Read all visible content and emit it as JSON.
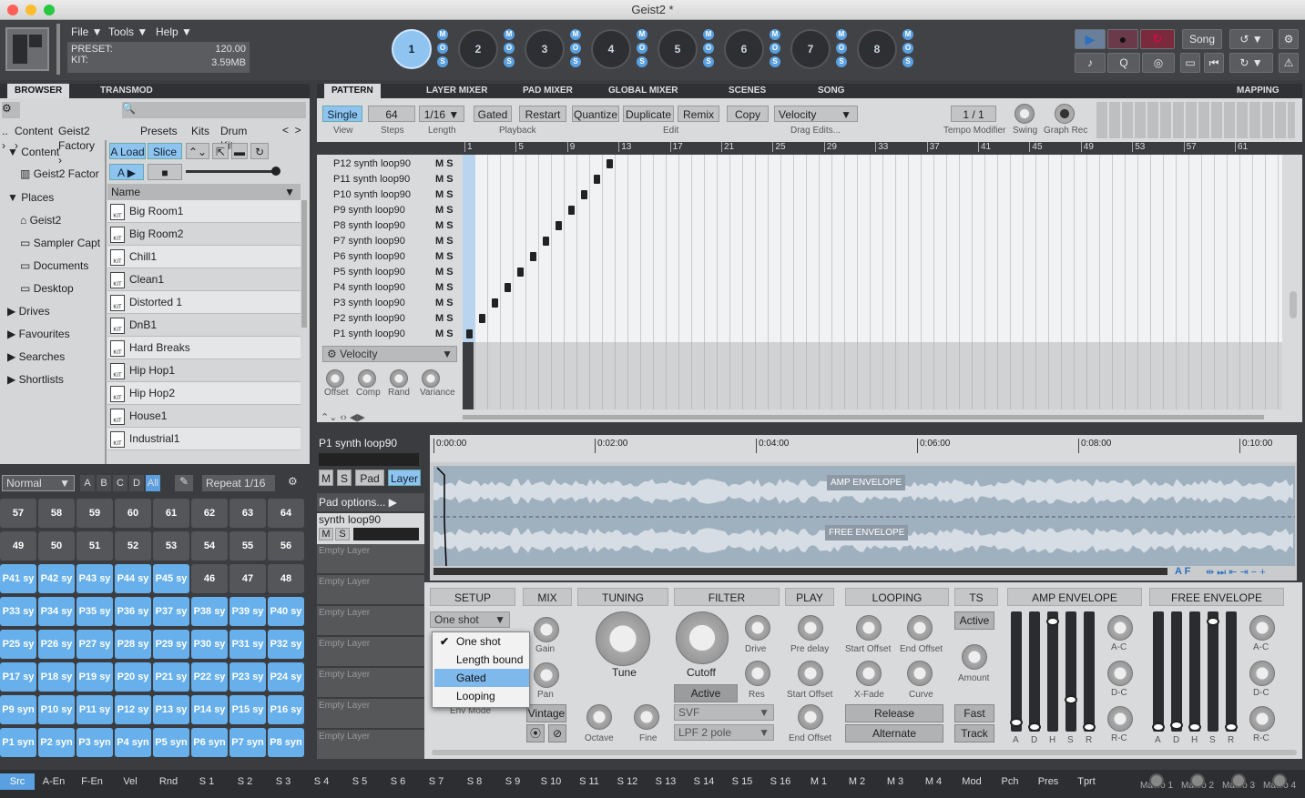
{
  "window": {
    "title": "Geist2 *"
  },
  "menu": {
    "file": "File ▼",
    "tools": "Tools ▼",
    "help": "Help ▼"
  },
  "info": {
    "preset_label": "PRESET:",
    "kit_label": "KIT:",
    "tempo": "120.00",
    "size": "3.59MB"
  },
  "engines": [
    "1",
    "2",
    "3",
    "4",
    "5",
    "6",
    "7",
    "8"
  ],
  "engine_flags": [
    "M",
    "O",
    "S"
  ],
  "transport": {
    "song": "Song"
  },
  "left_tabs": {
    "browser": "BROWSER",
    "transmod": "TRANSMOD"
  },
  "main_tabs": [
    "PATTERN",
    "LAYER MIXER",
    "PAD MIXER",
    "GLOBAL MIXER",
    "SCENES",
    "SONG"
  ],
  "mapping": "MAPPING",
  "breadcrumb": [
    "..",
    "Content",
    "Geist2 Factory",
    "Presets",
    "Kits",
    "Drum Kits"
  ],
  "tree": {
    "content": "Content",
    "geist2_factory": "Geist2 Factor",
    "places": "Places",
    "geist2": "Geist2",
    "sampler": "Sampler Capt",
    "documents": "Documents",
    "desktop": "Desktop",
    "drives": "Drives",
    "favourites": "Favourites",
    "searches": "Searches",
    "shortlists": "Shortlists"
  },
  "browser_btns": {
    "load": "A Load",
    "slice": "Slice",
    "a": "A ▶",
    "name": "Name"
  },
  "files": [
    "Big Room1",
    "Big Room2",
    "Chill1",
    "Clean1",
    "Distorted 1",
    "DnB1",
    "Hard Breaks",
    "Hip Hop1",
    "Hip Hop2",
    "House1",
    "Industrial1"
  ],
  "pads_toolbar": {
    "mode": "Normal",
    "banks": [
      "A",
      "B",
      "C",
      "D",
      "All"
    ],
    "repeat": "Repeat",
    "repeat_val": "1/16"
  },
  "pad_rows": [
    [
      "57",
      "58",
      "59",
      "60",
      "61",
      "62",
      "63",
      "64"
    ],
    [
      "49",
      "50",
      "51",
      "52",
      "53",
      "54",
      "55",
      "56"
    ],
    [
      "P41 sy",
      "P42 sy",
      "P43 sy",
      "P44 sy",
      "P45 sy",
      "46",
      "47",
      "48"
    ],
    [
      "P33 sy",
      "P34 sy",
      "P35 sy",
      "P36 sy",
      "P37 sy",
      "P38 sy",
      "P39 sy",
      "P40 sy"
    ],
    [
      "P25 sy",
      "P26 sy",
      "P27 sy",
      "P28 sy",
      "P29 sy",
      "P30 sy",
      "P31 sy",
      "P32 sy"
    ],
    [
      "P17 sy",
      "P18 sy",
      "P19 sy",
      "P20 sy",
      "P21 sy",
      "P22 sy",
      "P23 sy",
      "P24 sy"
    ],
    [
      "P9 syn",
      "P10 sy",
      "P11 sy",
      "P12 sy",
      "P13 sy",
      "P14 sy",
      "P15 sy",
      "P16 sy"
    ],
    [
      "P1 syn",
      "P2 syn",
      "P3 syn",
      "P4 syn",
      "P5 syn",
      "P6 syn",
      "P7 syn",
      "P8 syn"
    ]
  ],
  "pattern_toolbar": {
    "single": "Single",
    "steps": "64",
    "length": "1/16 ▼",
    "gated": "Gated",
    "restart": "Restart",
    "quantize": "Quantize",
    "duplicate": "Duplicate",
    "remix": "Remix",
    "copy": "Copy",
    "velocity": "Velocity",
    "page": "1 / 1",
    "view": "View",
    "steps_lbl": "Steps",
    "length_lbl": "Length",
    "playback": "Playback",
    "edit": "Edit",
    "drag": "Drag Edits...",
    "tempo_mod": "Tempo Modifier",
    "swing": "Swing",
    "graph_rec": "Graph Rec"
  },
  "ruler": [
    "1",
    "5",
    "9",
    "13",
    "17",
    "21",
    "25",
    "29",
    "33",
    "37",
    "41",
    "45",
    "49",
    "53",
    "57",
    "61"
  ],
  "pattern_rows": [
    "P12 synth loop90",
    "P11 synth loop90",
    "P10 synth loop90",
    "P9 synth loop90",
    "P8 synth loop90",
    "P7 synth loop90",
    "P6 synth loop90",
    "P5 synth loop90",
    "P4 synth loop90",
    "P3 synth loop90",
    "P2 synth loop90",
    "P1 synth loop90"
  ],
  "ms_labels": "M S",
  "vel_lane": {
    "label": "Velocity",
    "knobs": [
      "Offset",
      "Comp",
      "Rand",
      "Variance"
    ]
  },
  "pad_panel": {
    "title": "P1 synth loop90",
    "m": "M",
    "s": "S",
    "pad": "Pad",
    "layer": "Layer",
    "pad_options": "Pad options... ▶",
    "layer_name": "synth loop90",
    "empty": "Empty Layer"
  },
  "wave": {
    "times": [
      "0:00:00",
      "0:02:00",
      "0:04:00",
      "0:06:00",
      "0:08:00",
      "0:10:00"
    ],
    "amp": "AMP ENVELOPE",
    "free": "FREE ENVELOPE",
    "af": "A F"
  },
  "sections": {
    "setup": "SETUP",
    "mix": "MIX",
    "tuning": "TUNING",
    "filter": "FILTER",
    "play": "PLAY",
    "looping": "LOOPING",
    "ts": "TS",
    "amp": "AMP ENVELOPE",
    "free": "FREE ENVELOPE"
  },
  "setup": {
    "mode": "One shot",
    "env_mode": "Env Mode",
    "options": [
      "One shot",
      "Length bound",
      "Gated",
      "Looping"
    ]
  },
  "mix": {
    "gain": "Gain",
    "pan": "Pan",
    "vintage": "Vintage"
  },
  "tuning": {
    "tune": "Tune",
    "octave": "Octave",
    "fine": "Fine"
  },
  "filter": {
    "cutoff": "Cutoff",
    "drive": "Drive",
    "res": "Res",
    "active": "Active",
    "type": "SVF",
    "pole": "LPF 2 pole"
  },
  "play": {
    "pre_delay": "Pre delay",
    "start_offset": "Start Offset",
    "end_offset": "End Offset"
  },
  "looping": {
    "start": "Start Offset",
    "end": "End Offset",
    "xfade": "X-Fade",
    "curve": "Curve",
    "release": "Release",
    "alternate": "Alternate"
  },
  "ts": {
    "active": "Active",
    "amount": "Amount",
    "fast": "Fast",
    "track": "Track"
  },
  "env_labels": [
    "A",
    "D",
    "H",
    "S",
    "R"
  ],
  "env_knobs": [
    "A-C",
    "D-C",
    "R-C"
  ],
  "bottom": [
    "Src",
    "A-En",
    "F-En",
    "Vel",
    "Rnd",
    "S 1",
    "S 2",
    "S 3",
    "S 4",
    "S 5",
    "S 6",
    "S 7",
    "S 8",
    "S 9",
    "S 10",
    "S 11",
    "S 12",
    "S 13",
    "S 14",
    "S 15",
    "S 16",
    "M 1",
    "M 2",
    "M 3",
    "M 4",
    "Mod",
    "Pch",
    "Pres",
    "Tprt"
  ],
  "macros": [
    "Macro 1",
    "Macro 2",
    "Macro 3",
    "Macro 4"
  ],
  "colors": {
    "accent": "#67b0ec",
    "bg": "#3a3c40"
  }
}
